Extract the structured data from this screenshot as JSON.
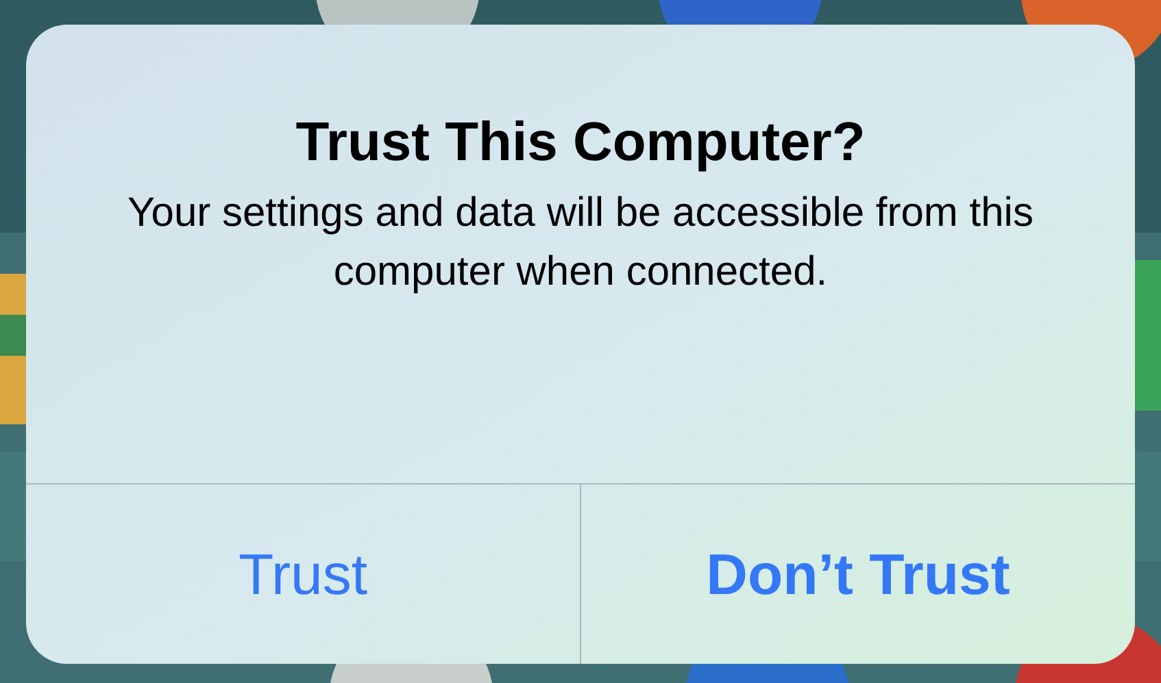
{
  "alert": {
    "title": "Trust This Computer?",
    "message": "Your settings and data will be accessible from this computer when connected.",
    "buttons": [
      {
        "label": "Trust",
        "kind": "default"
      },
      {
        "label": "Don’t Trust",
        "kind": "preferred"
      }
    ]
  }
}
